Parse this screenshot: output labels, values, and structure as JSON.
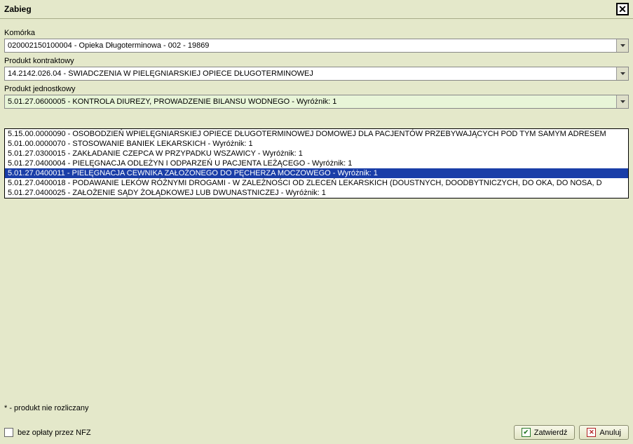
{
  "title": "Zabieg",
  "fields": {
    "komorka": {
      "label": "Komórka",
      "value": "020002150100004 - Opieka Długoterminowa - 002 - 19869"
    },
    "produkt_kontraktowy": {
      "label": "Produkt kontraktowy",
      "value": "14.2142.026.04 - ŚWIADCZENIA  W PIELĘGNIARSKIEJ  OPIECE DŁUGOTERMINOWEJ"
    },
    "produkt_jednostkowy": {
      "label": "Produkt jednostkowy",
      "value": "5.01.27.0600005 - KONTROLA DIUREZY, PROWADZENIE BILANSU WODNEGO - Wyróżnik: 1",
      "options": [
        "5.15.00.0000090 - OSOBODZIEŃ WPIELĘGNIARSKIEJ OPIECE DŁUGOTERMINOWEJ DOMOWEJ DLA PACJENTÓW PRZEBYWAJĄCYCH POD TYM SAMYM ADRESEM",
        "5.01.00.0000070 - STOSOWANIE BANIEK LEKARSKICH - Wyróżnik: 1",
        "5.01.27.0300015 - ZAKŁADANIE CZEPCA W PRZYPADKU WSZAWICY - Wyróżnik: 1",
        "5.01.27.0400004 - PIELĘGNACJA ODLEŻYN I ODPARZEŃ U PACJENTA LEŻĄCEGO - Wyróżnik: 1",
        "5.01.27.0400011 - PIELĘGNACJA CEWNIKA ZAŁOŻONEGO DO PĘCHERZA MOCZOWEGO - Wyróżnik: 1",
        "5.01.27.0400018 - PODAWANIE LEKÓW RÓŻNYMI DROGAMI - W ZALEŻNOŚCI OD ZLECEŃ LEKARSKICH (DOUSTNYCH, DOODBYTNICZYCH, DO OKA, DO NOSA, D",
        "5.01.27.0400025 - ZAŁOŻENIE SĄDY ŻOŁĄDKOWEJ LUB DWUNASTNICZEJ - Wyróżnik: 1"
      ],
      "highlighted_index": 4
    }
  },
  "footer_note": "* - produkt nie rozliczany",
  "checkbox_bez_oplaty": "bez opłaty przez NFZ",
  "buttons": {
    "confirm": "Zatwierdź",
    "cancel": "Anuluj"
  }
}
